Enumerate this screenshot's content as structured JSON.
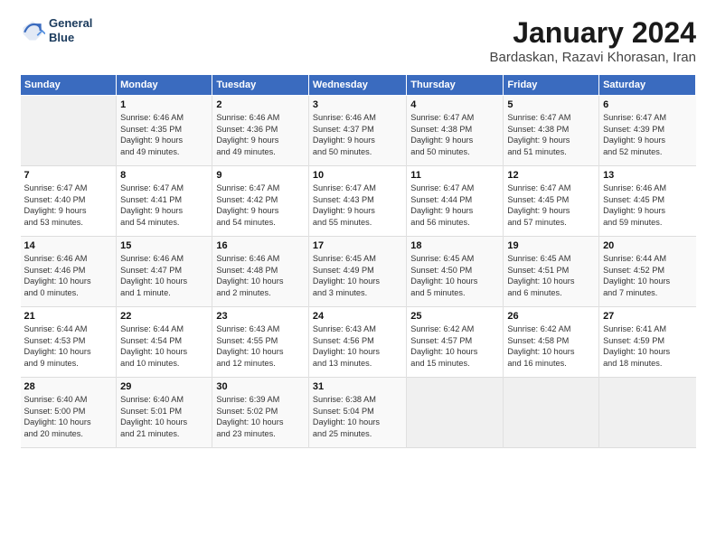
{
  "header": {
    "logo_line1": "General",
    "logo_line2": "Blue",
    "title": "January 2024",
    "subtitle": "Bardaskan, Razavi Khorasan, Iran"
  },
  "weekdays": [
    "Sunday",
    "Monday",
    "Tuesday",
    "Wednesday",
    "Thursday",
    "Friday",
    "Saturday"
  ],
  "weeks": [
    [
      {
        "day": "",
        "info": ""
      },
      {
        "day": "1",
        "info": "Sunrise: 6:46 AM\nSunset: 4:35 PM\nDaylight: 9 hours\nand 49 minutes."
      },
      {
        "day": "2",
        "info": "Sunrise: 6:46 AM\nSunset: 4:36 PM\nDaylight: 9 hours\nand 49 minutes."
      },
      {
        "day": "3",
        "info": "Sunrise: 6:46 AM\nSunset: 4:37 PM\nDaylight: 9 hours\nand 50 minutes."
      },
      {
        "day": "4",
        "info": "Sunrise: 6:47 AM\nSunset: 4:38 PM\nDaylight: 9 hours\nand 50 minutes."
      },
      {
        "day": "5",
        "info": "Sunrise: 6:47 AM\nSunset: 4:38 PM\nDaylight: 9 hours\nand 51 minutes."
      },
      {
        "day": "6",
        "info": "Sunrise: 6:47 AM\nSunset: 4:39 PM\nDaylight: 9 hours\nand 52 minutes."
      }
    ],
    [
      {
        "day": "7",
        "info": "Sunrise: 6:47 AM\nSunset: 4:40 PM\nDaylight: 9 hours\nand 53 minutes."
      },
      {
        "day": "8",
        "info": "Sunrise: 6:47 AM\nSunset: 4:41 PM\nDaylight: 9 hours\nand 54 minutes."
      },
      {
        "day": "9",
        "info": "Sunrise: 6:47 AM\nSunset: 4:42 PM\nDaylight: 9 hours\nand 54 minutes."
      },
      {
        "day": "10",
        "info": "Sunrise: 6:47 AM\nSunset: 4:43 PM\nDaylight: 9 hours\nand 55 minutes."
      },
      {
        "day": "11",
        "info": "Sunrise: 6:47 AM\nSunset: 4:44 PM\nDaylight: 9 hours\nand 56 minutes."
      },
      {
        "day": "12",
        "info": "Sunrise: 6:47 AM\nSunset: 4:45 PM\nDaylight: 9 hours\nand 57 minutes."
      },
      {
        "day": "13",
        "info": "Sunrise: 6:46 AM\nSunset: 4:45 PM\nDaylight: 9 hours\nand 59 minutes."
      }
    ],
    [
      {
        "day": "14",
        "info": "Sunrise: 6:46 AM\nSunset: 4:46 PM\nDaylight: 10 hours\nand 0 minutes."
      },
      {
        "day": "15",
        "info": "Sunrise: 6:46 AM\nSunset: 4:47 PM\nDaylight: 10 hours\nand 1 minute."
      },
      {
        "day": "16",
        "info": "Sunrise: 6:46 AM\nSunset: 4:48 PM\nDaylight: 10 hours\nand 2 minutes."
      },
      {
        "day": "17",
        "info": "Sunrise: 6:45 AM\nSunset: 4:49 PM\nDaylight: 10 hours\nand 3 minutes."
      },
      {
        "day": "18",
        "info": "Sunrise: 6:45 AM\nSunset: 4:50 PM\nDaylight: 10 hours\nand 5 minutes."
      },
      {
        "day": "19",
        "info": "Sunrise: 6:45 AM\nSunset: 4:51 PM\nDaylight: 10 hours\nand 6 minutes."
      },
      {
        "day": "20",
        "info": "Sunrise: 6:44 AM\nSunset: 4:52 PM\nDaylight: 10 hours\nand 7 minutes."
      }
    ],
    [
      {
        "day": "21",
        "info": "Sunrise: 6:44 AM\nSunset: 4:53 PM\nDaylight: 10 hours\nand 9 minutes."
      },
      {
        "day": "22",
        "info": "Sunrise: 6:44 AM\nSunset: 4:54 PM\nDaylight: 10 hours\nand 10 minutes."
      },
      {
        "day": "23",
        "info": "Sunrise: 6:43 AM\nSunset: 4:55 PM\nDaylight: 10 hours\nand 12 minutes."
      },
      {
        "day": "24",
        "info": "Sunrise: 6:43 AM\nSunset: 4:56 PM\nDaylight: 10 hours\nand 13 minutes."
      },
      {
        "day": "25",
        "info": "Sunrise: 6:42 AM\nSunset: 4:57 PM\nDaylight: 10 hours\nand 15 minutes."
      },
      {
        "day": "26",
        "info": "Sunrise: 6:42 AM\nSunset: 4:58 PM\nDaylight: 10 hours\nand 16 minutes."
      },
      {
        "day": "27",
        "info": "Sunrise: 6:41 AM\nSunset: 4:59 PM\nDaylight: 10 hours\nand 18 minutes."
      }
    ],
    [
      {
        "day": "28",
        "info": "Sunrise: 6:40 AM\nSunset: 5:00 PM\nDaylight: 10 hours\nand 20 minutes."
      },
      {
        "day": "29",
        "info": "Sunrise: 6:40 AM\nSunset: 5:01 PM\nDaylight: 10 hours\nand 21 minutes."
      },
      {
        "day": "30",
        "info": "Sunrise: 6:39 AM\nSunset: 5:02 PM\nDaylight: 10 hours\nand 23 minutes."
      },
      {
        "day": "31",
        "info": "Sunrise: 6:38 AM\nSunset: 5:04 PM\nDaylight: 10 hours\nand 25 minutes."
      },
      {
        "day": "",
        "info": ""
      },
      {
        "day": "",
        "info": ""
      },
      {
        "day": "",
        "info": ""
      }
    ]
  ]
}
